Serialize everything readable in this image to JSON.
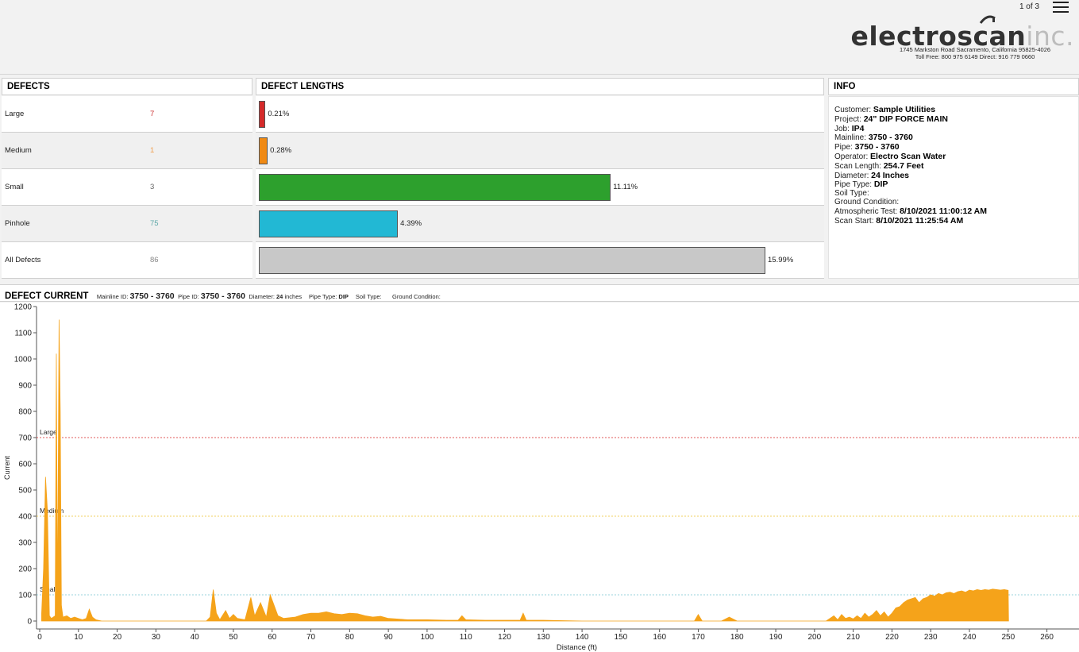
{
  "header": {
    "page_indicator": "1 of 3",
    "logo_dark": "electro",
    "logo_dark2": "scan",
    "logo_light": "inc.",
    "address_line1": "1745 Markston Road Sacramento, California 95825-4026",
    "address_line2": "Toll Free: 800 975 6149 Direct: 916 779 0660"
  },
  "panels": {
    "defects_title": "DEFECTS",
    "lengths_title": "DEFECT LENGTHS",
    "info_title": "INFO"
  },
  "defects": [
    {
      "label": "Large",
      "count": "7",
      "pct_label": "0.21%",
      "pct": 0.21,
      "color": "#d42a2a",
      "count_color": "#cc3333"
    },
    {
      "label": "Medium",
      "count": "1",
      "pct_label": "0.28%",
      "pct": 0.28,
      "color": "#f08a14",
      "count_color": "#f0a050"
    },
    {
      "label": "Small",
      "count": "3",
      "pct_label": "11.11%",
      "pct": 11.11,
      "color": "#2da02d",
      "count_color": "#666666"
    },
    {
      "label": "Pinhole",
      "count": "75",
      "pct_label": "4.39%",
      "pct": 4.39,
      "color": "#22b8d4",
      "count_color": "#5fa8a8"
    },
    {
      "label": "All Defects",
      "count": "86",
      "pct_label": "15.99%",
      "pct": 15.99,
      "color": "#c8c8c8",
      "count_color": "#888888"
    }
  ],
  "info": {
    "customer_label": "Customer:",
    "customer": "Sample Utilities",
    "project_label": "Project:",
    "project": "24\" DIP FORCE MAIN",
    "job_label": "Job:",
    "job": "IP4",
    "mainline_label": "Mainline:",
    "mainline": "3750 - 3760",
    "pipe_label": "Pipe:",
    "pipe": "3750 - 3760",
    "operator_label": "Operator:",
    "operator": "Electro Scan Water",
    "scan_length_label": "Scan Length:",
    "scan_length": "254.7 Feet",
    "diameter_label": "Diameter:",
    "diameter": "24 Inches",
    "pipe_type_label": "Pipe Type:",
    "pipe_type": "DIP",
    "soil_type_label": "Soil Type:",
    "ground_label": "Ground Condition:",
    "atmo_label": "Atmospheric Test:",
    "atmo": "8/10/2021 11:00:12 AM",
    "scan_start_label": "Scan Start:",
    "scan_start": "8/10/2021 11:25:54 AM"
  },
  "current": {
    "title": "DEFECT CURRENT",
    "mainline_label": "Mainline ID:",
    "mainline": "3750 - 3760",
    "pipe_label": "Pipe ID:",
    "pipe": "3750 - 3760",
    "diameter_label": "Diameter:",
    "diameter": "24",
    "diameter_unit": "inches",
    "pipe_type_label": "Pipe Type:",
    "pipe_type": "DIP",
    "soil_label": "Soil Type:",
    "ground_label": "Ground Condition:"
  },
  "chart_data": {
    "type": "area",
    "xlabel": "Distance (ft)",
    "ylabel": "Current",
    "xlim": [
      0,
      265
    ],
    "ylim": [
      0,
      1200
    ],
    "x_ticks": [
      0,
      10,
      20,
      30,
      40,
      50,
      60,
      70,
      80,
      90,
      100,
      110,
      120,
      130,
      140,
      150,
      160,
      170,
      180,
      190,
      200,
      210,
      220,
      230,
      240,
      250,
      260
    ],
    "y_ticks": [
      0,
      100,
      200,
      300,
      400,
      500,
      600,
      700,
      800,
      900,
      1000,
      1100,
      1200
    ],
    "series_color": "#f5a31a",
    "thresholds": [
      {
        "label": "Large",
        "value": 700,
        "color": "#e05a5a"
      },
      {
        "label": "Medium",
        "value": 400,
        "color": "#f0d060"
      },
      {
        "label": "Small",
        "value": 100,
        "color": "#9ad3de"
      }
    ],
    "x": [
      0.5,
      1.0,
      1.5,
      2.0,
      2.5,
      3.0,
      3.5,
      4.0,
      4.3,
      4.6,
      5.0,
      5.3,
      5.6,
      6.0,
      7.0,
      8.0,
      9.0,
      10.0,
      11.0,
      12.0,
      12.8,
      13.6,
      14.5,
      16.0,
      20.0,
      30.0,
      40.0,
      43.0,
      44.0,
      44.8,
      45.6,
      46.5,
      48.0,
      49.0,
      50.0,
      51.0,
      53.0,
      54.5,
      55.5,
      57.0,
      58.5,
      59.5,
      60.5,
      61.5,
      63.0,
      66.0,
      68.0,
      70.0,
      72.0,
      74.0,
      76.0,
      78.0,
      80.0,
      82.0,
      84.0,
      86.0,
      88.0,
      90.0,
      95.0,
      100.0,
      105.0,
      108.0,
      109.0,
      110.0,
      115.0,
      120.0,
      124.0,
      124.8,
      125.6,
      130.0,
      140.0,
      150.0,
      160.0,
      169.0,
      170.0,
      171.0,
      176.0,
      178.0,
      180.0,
      190.0,
      200.0,
      203.0,
      204.0,
      205.0,
      206.0,
      207.0,
      208.0,
      209.0,
      210.0,
      211.0,
      212.0,
      213.0,
      214.0,
      215.0,
      216.0,
      217.0,
      218.0,
      219.0,
      220.0,
      221.0,
      222.0,
      223.0,
      224.0,
      225.0,
      226.0,
      227.0,
      228.0,
      229.0,
      230.0,
      231.0,
      232.0,
      233.0,
      234.0,
      235.0,
      236.0,
      237.0,
      238.0,
      239.0,
      240.0,
      241.0,
      242.0,
      243.0,
      244.0,
      245.0,
      246.0,
      247.0,
      248.0,
      249.0,
      250.0,
      250.1
    ],
    "values": [
      30,
      200,
      550,
      420,
      20,
      10,
      15,
      20,
      1020,
      50,
      1150,
      800,
      60,
      15,
      20,
      10,
      15,
      10,
      5,
      10,
      45,
      15,
      5,
      0,
      0,
      0,
      0,
      0,
      15,
      120,
      30,
      5,
      40,
      10,
      25,
      10,
      5,
      90,
      20,
      70,
      15,
      100,
      60,
      20,
      10,
      15,
      25,
      30,
      30,
      35,
      28,
      25,
      30,
      28,
      20,
      15,
      18,
      10,
      5,
      5,
      3,
      3,
      20,
      5,
      3,
      3,
      3,
      30,
      3,
      3,
      0,
      0,
      0,
      0,
      25,
      0,
      0,
      15,
      0,
      0,
      0,
      0,
      10,
      20,
      5,
      25,
      10,
      15,
      8,
      20,
      10,
      30,
      15,
      25,
      40,
      20,
      35,
      15,
      30,
      50,
      55,
      70,
      80,
      85,
      90,
      70,
      85,
      90,
      100,
      95,
      105,
      100,
      108,
      110,
      105,
      112,
      115,
      110,
      118,
      115,
      120,
      117,
      120,
      118,
      122,
      120,
      118,
      120,
      117,
      0
    ]
  }
}
